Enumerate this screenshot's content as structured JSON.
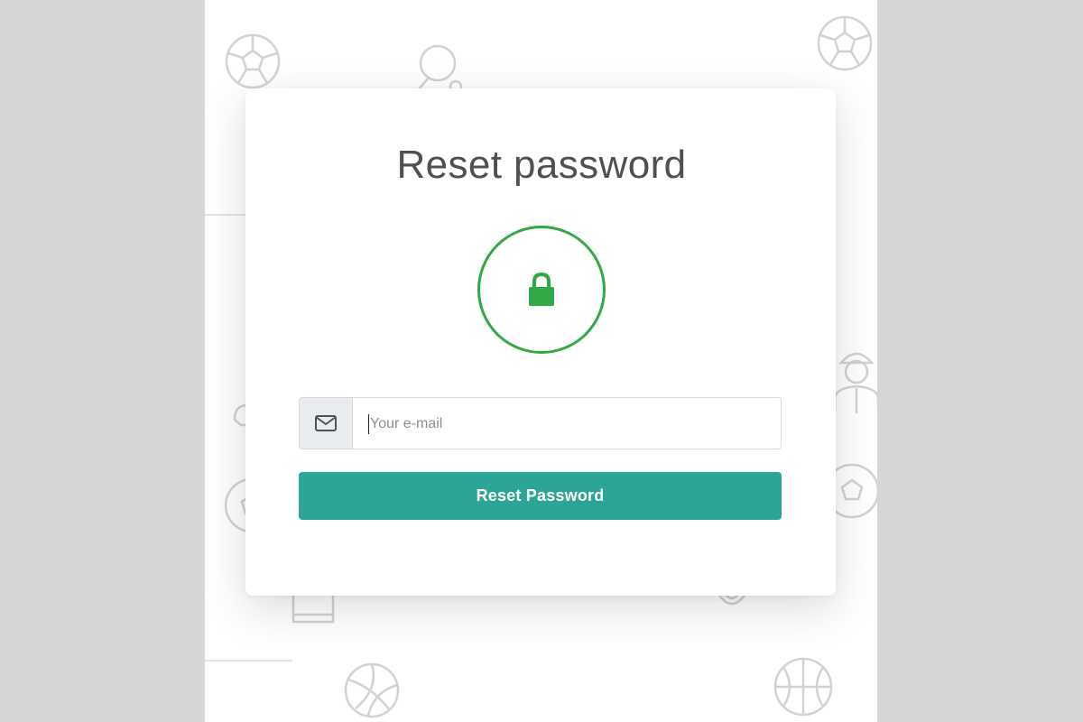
{
  "page": {
    "title": "Reset password",
    "email_placeholder": "Your e-mail",
    "submit_label": "Reset Password"
  },
  "colors": {
    "backdrop": "#d6d6d6",
    "accent_green": "#33a846",
    "button_teal": "#2ca596",
    "pattern_gray": "#d2d2d2"
  },
  "icons": {
    "lock": "lock-icon",
    "email": "envelope-icon",
    "background_pattern": [
      "soccer-ball-icon",
      "ping-pong-paddle-icon",
      "referee-icon",
      "football-helmet-icon",
      "jersey-icon",
      "shield-icon",
      "volleyball-icon",
      "basketball-icon"
    ]
  }
}
